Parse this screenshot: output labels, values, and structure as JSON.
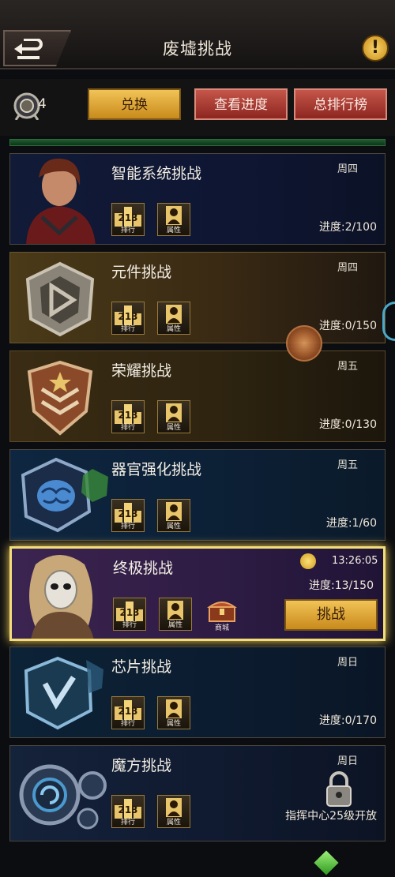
{
  "header": {
    "title": "废墟挑战",
    "back_icon": "back-arrow-icon",
    "info_icon": "exclamation-icon",
    "info_label": "!"
  },
  "toolbar": {
    "medal_count": "4",
    "exchange_label": "兑换",
    "progress_label": "查看进度",
    "ranking_label": "总排行榜"
  },
  "common": {
    "rank_caption": "排行",
    "attr_caption": "属性",
    "rank_number": "213"
  },
  "challenges": [
    {
      "title": "智能系统挑战",
      "day": "周四",
      "progress": "进度:2/100"
    },
    {
      "title": "元件挑战",
      "day": "周四",
      "progress": "进度:0/150"
    },
    {
      "title": "荣耀挑战",
      "day": "周五",
      "progress": "进度:0/130"
    },
    {
      "title": "器官强化挑战",
      "day": "周五",
      "progress": "进度:1/60"
    },
    {
      "title": "终极挑战",
      "timer": "13:26:05",
      "progress": "进度:13/150",
      "shop_caption": "商城",
      "fight_label": "挑战"
    },
    {
      "title": "芯片挑战",
      "day": "周日",
      "progress": "进度:0/170"
    },
    {
      "title": "魔方挑战",
      "day": "周日",
      "unlock_text": "指挥中心25级开放"
    }
  ],
  "colors": {
    "gold": "#f1c356",
    "red": "#c5564a",
    "highlight": "#f3dd7a"
  }
}
